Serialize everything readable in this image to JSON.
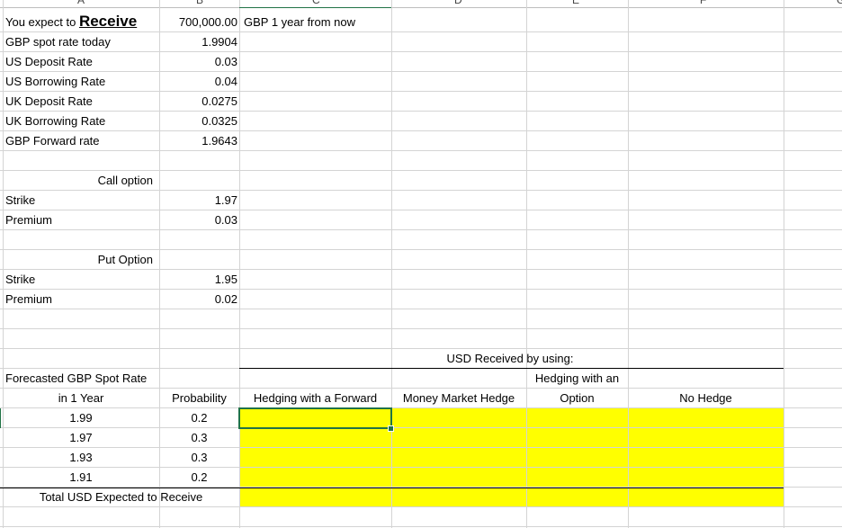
{
  "column_headers": [
    "A",
    "B",
    "C",
    "D",
    "E",
    "F",
    "G"
  ],
  "inputs": {
    "expect_prefix": "You expect to",
    "expect_word": "Receive",
    "amount": "700,000.00",
    "amount_note": "GBP 1 year from now",
    "rows": [
      {
        "label": "GBP spot rate today",
        "value": "1.9904"
      },
      {
        "label": "US Deposit Rate",
        "value": "0.03"
      },
      {
        "label": "US Borrowing Rate",
        "value": "0.04"
      },
      {
        "label": "UK Deposit Rate",
        "value": "0.0275"
      },
      {
        "label": "UK Borrowing Rate",
        "value": "0.0325"
      },
      {
        "label": "GBP Forward rate",
        "value": "1.9643"
      }
    ]
  },
  "call_option": {
    "title": "Call option",
    "strike_label": "Strike",
    "strike": "1.97",
    "premium_label": "Premium",
    "premium": "0.03"
  },
  "put_option": {
    "title": "Put Option",
    "strike_label": "Strike",
    "strike": "1.95",
    "premium_label": "Premium",
    "premium": "0.02"
  },
  "table": {
    "group_header": "USD Received by using:",
    "forecast_header_line1": "Forecasted GBP Spot Rate",
    "forecast_header_line2": "in 1 Year",
    "probability_header": "Probability",
    "forward_header": "Hedging with a Forward",
    "money_market_header": "Money Market Hedge",
    "option_header_line1": "Hedging with an",
    "option_header_line2": "Option",
    "no_hedge_header": "No Hedge",
    "rows": [
      {
        "rate": "1.99",
        "prob": "0.2"
      },
      {
        "rate": "1.97",
        "prob": "0.3"
      },
      {
        "rate": "1.93",
        "prob": "0.3"
      },
      {
        "rate": "1.91",
        "prob": "0.2"
      }
    ],
    "total_label": "Total USD Expected to Receive"
  },
  "colors": {
    "input_fill": "#ffff00",
    "selection": "#217346",
    "gridline": "#d4d4d4"
  }
}
